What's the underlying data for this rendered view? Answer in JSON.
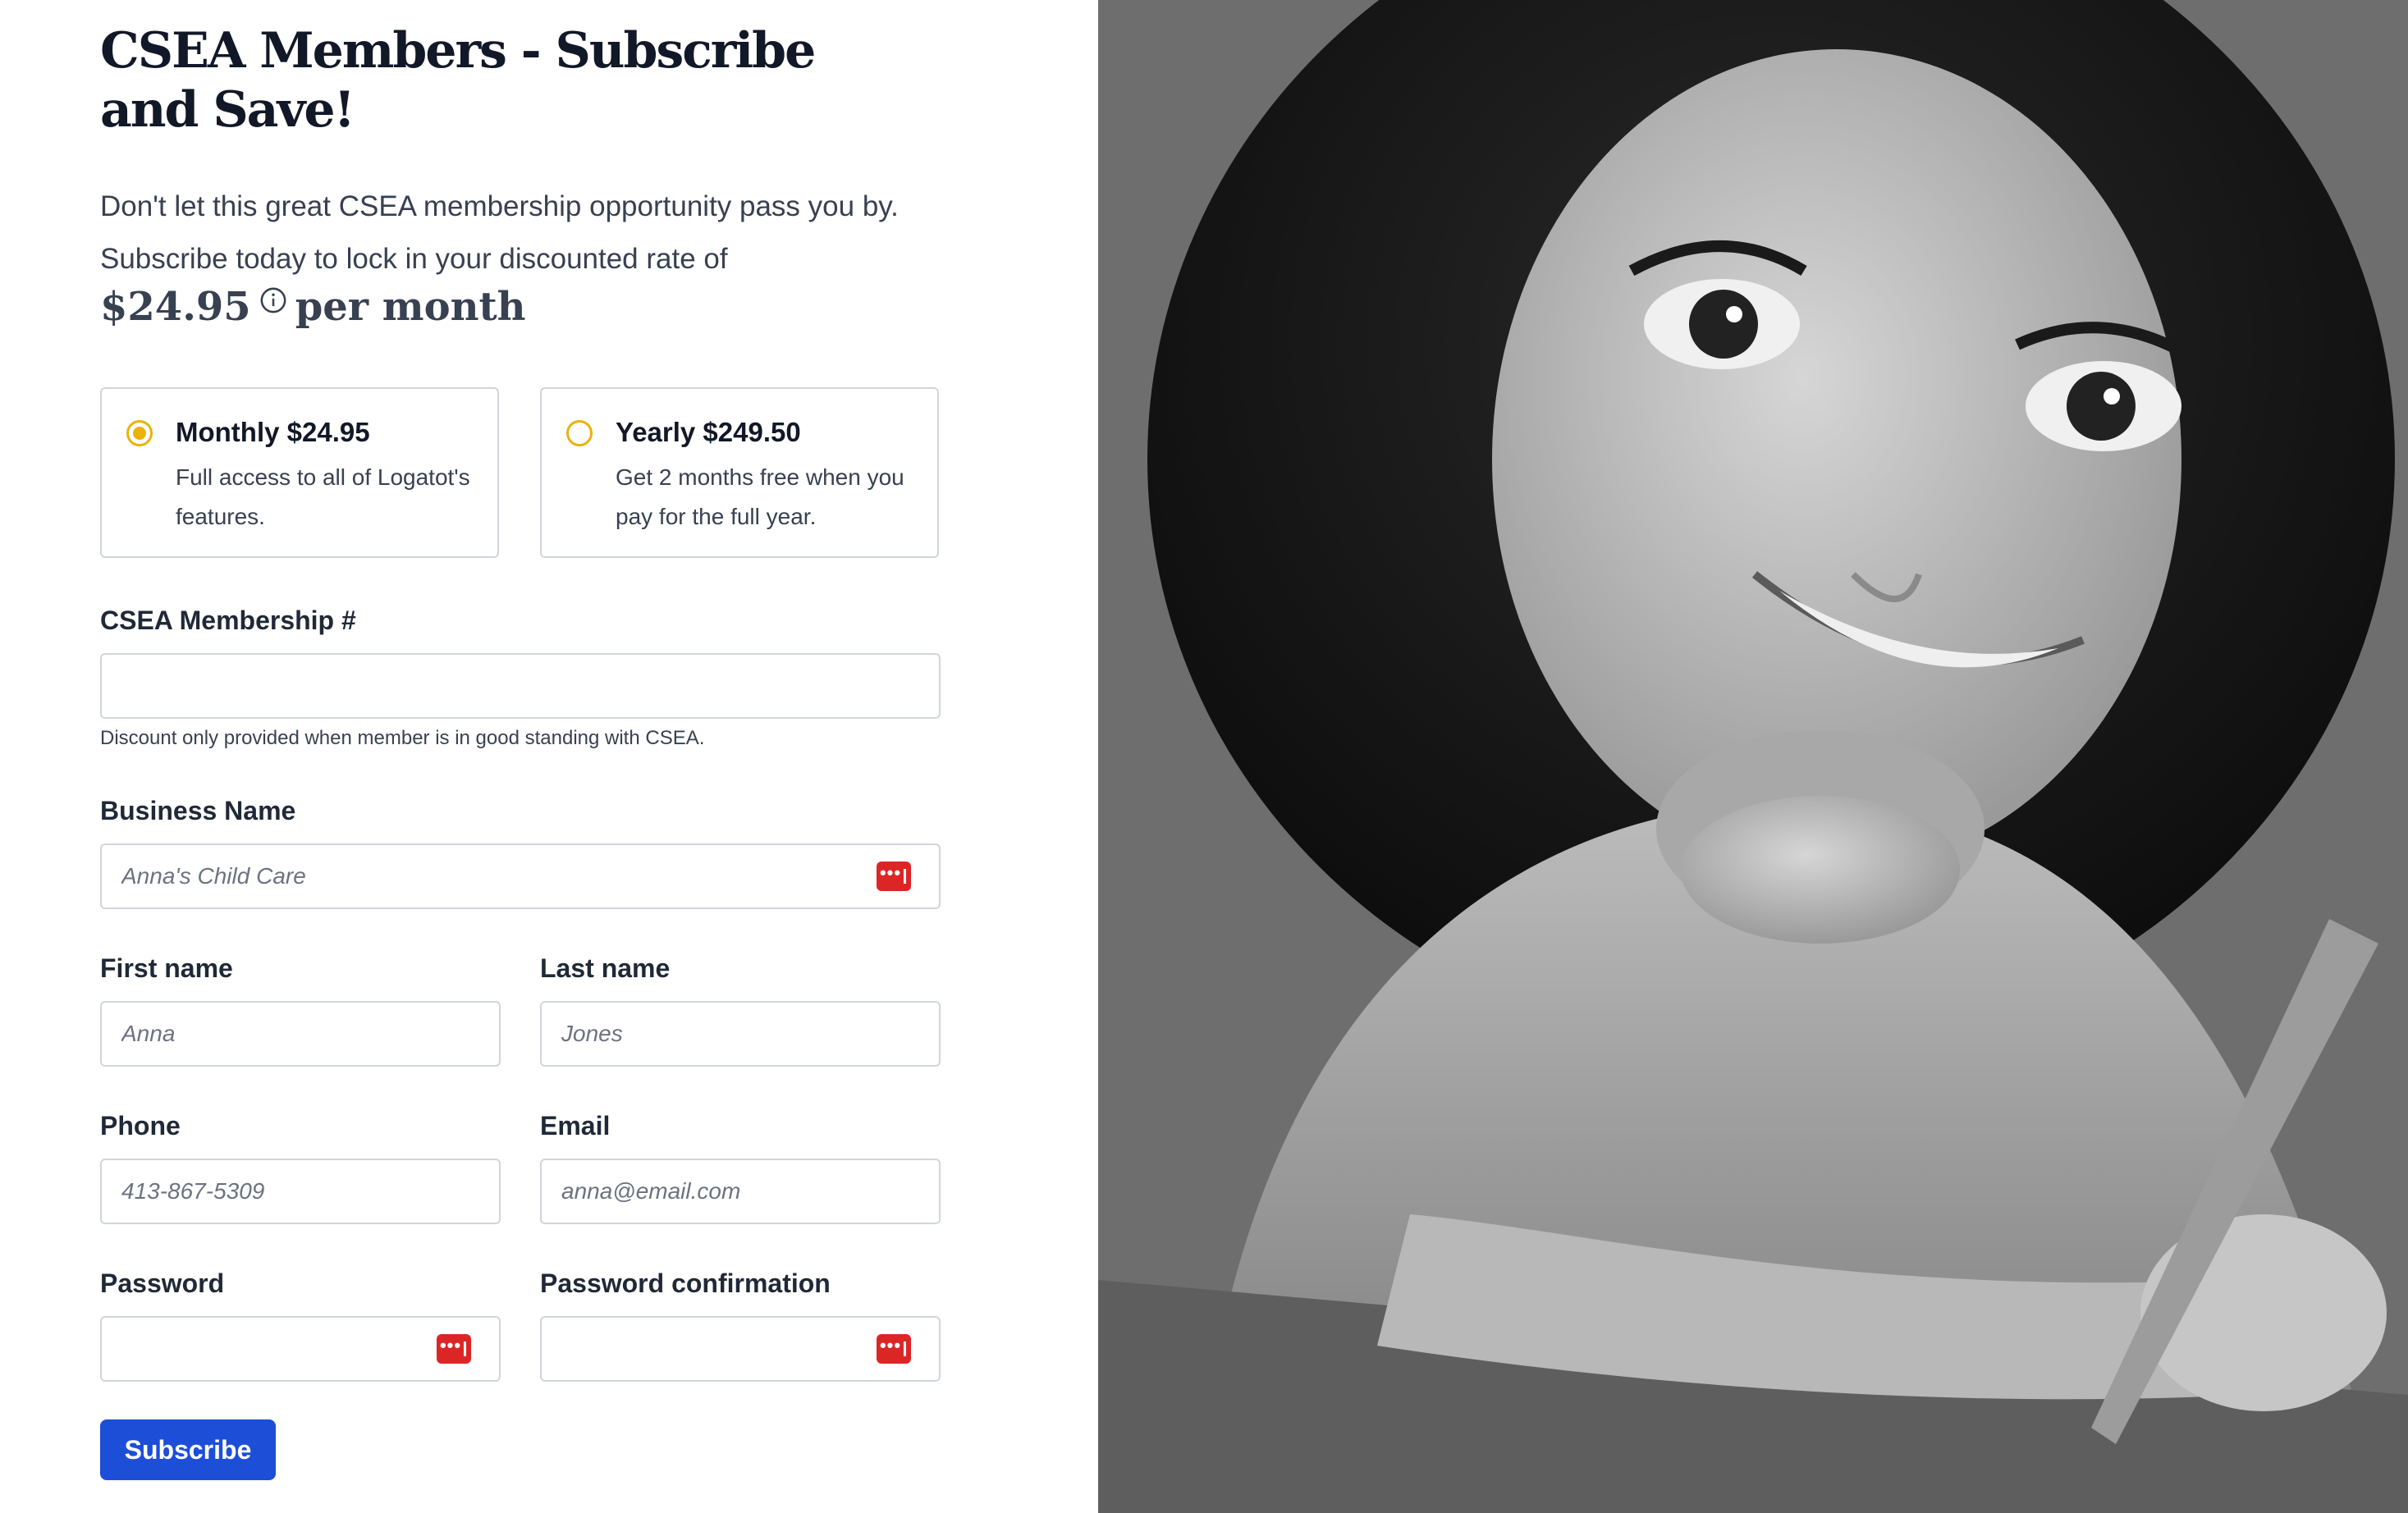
{
  "page": {
    "title": "CSEA Members - Subscribe and Save!",
    "intro_line1": "Don't let this great CSEA membership opportunity pass you by.",
    "intro_line2": "Subscribe today to lock in your discounted rate of",
    "price": "$24.95",
    "price_suffix": "per month"
  },
  "plans": [
    {
      "title": "Monthly $24.95",
      "description": "Full access to all of Logatot's features.",
      "selected": true
    },
    {
      "title": "Yearly $249.50",
      "description": "Get 2 months free when you pay for the full year.",
      "selected": false
    }
  ],
  "form": {
    "membership": {
      "label": "CSEA Membership #",
      "value": "",
      "help": "Discount only provided when member is in good standing with CSEA."
    },
    "business": {
      "label": "Business Name",
      "placeholder": "Anna's Child Care"
    },
    "first_name": {
      "label": "First name",
      "placeholder": "Anna"
    },
    "last_name": {
      "label": "Last name",
      "placeholder": "Jones"
    },
    "phone": {
      "label": "Phone",
      "placeholder": "413-867-5309"
    },
    "email": {
      "label": "Email",
      "placeholder": "anna@email.com"
    },
    "password": {
      "label": "Password",
      "value": ""
    },
    "password_confirmation": {
      "label": "Password confirmation",
      "value": ""
    },
    "submit_label": "Subscribe"
  },
  "icons": {
    "info": "info-icon",
    "password_manager": "password-manager-icon"
  },
  "colors": {
    "accent": "#1d4ed8",
    "radio": "#eab308",
    "password_manager": "#dc2626"
  }
}
